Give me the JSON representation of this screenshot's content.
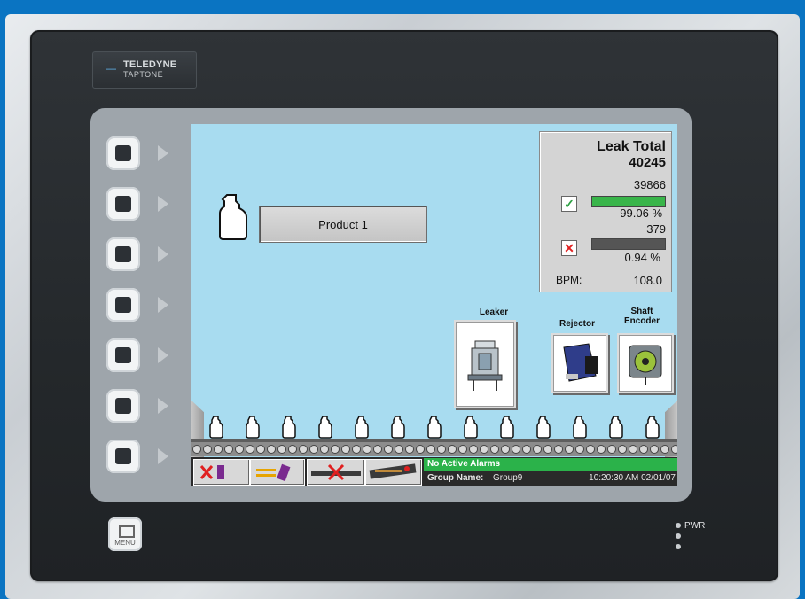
{
  "brand": {
    "line1": "TELEDYNE",
    "line2": "TAPTONE"
  },
  "product": {
    "label": "Product 1"
  },
  "leak_panel": {
    "title": "Leak Total",
    "total": "40245",
    "good_count": "39866",
    "good_percent": "99.06 %",
    "good_fraction": 0.9906,
    "bad_count": "379",
    "bad_percent": "0.94 %",
    "bpm_label": "BPM:",
    "bpm_value": "108.0",
    "colors": {
      "good_bar": "#39b54a",
      "bad_bar": "#555555"
    }
  },
  "devices": {
    "leaker": "Leaker",
    "rejector": "Rejector",
    "encoder_line1": "Shaft",
    "encoder_line2": "Encoder"
  },
  "status": {
    "alarm": "No Active Alarms",
    "group_label": "Group Name:",
    "group_value": "Group9",
    "timestamp": "10:20:30 AM 02/01/07"
  },
  "menu_label": "MENU",
  "pwr_label": "PWR",
  "nav_buttons": [
    {
      "icon": "reject-container-icon"
    },
    {
      "icon": "transfer-container-icon"
    },
    {
      "icon": "conveyor-reject-icon"
    },
    {
      "icon": "conveyor-encoder-icon"
    }
  ]
}
